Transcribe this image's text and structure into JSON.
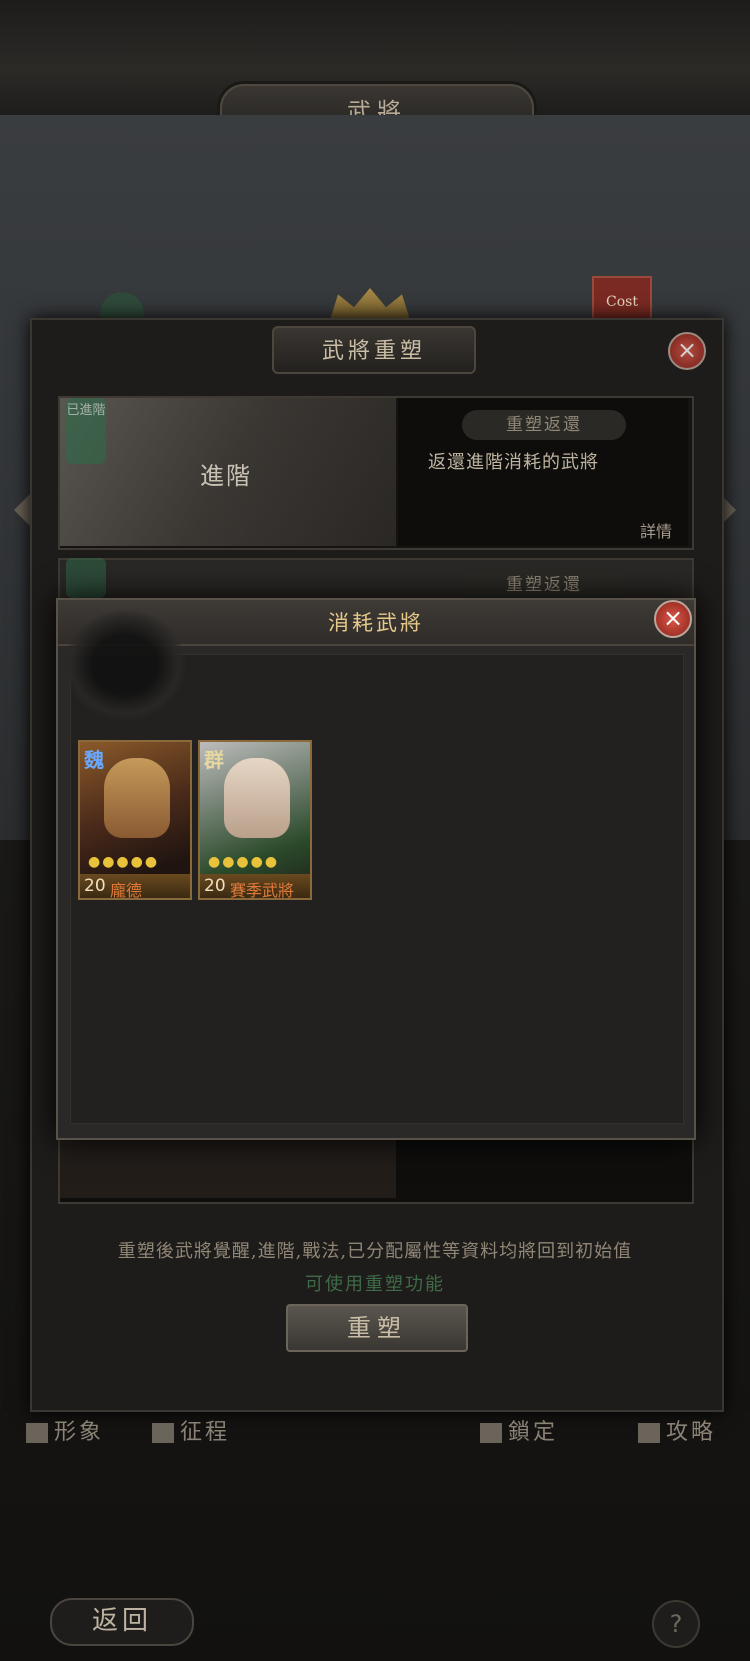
{
  "header": {
    "title": "武將"
  },
  "cost_badge": "Cost",
  "reset_dialog": {
    "title": "武將重塑",
    "card1": {
      "tag": "已進階",
      "label": "進階",
      "button": "重塑返還",
      "description": "返還進階消耗的武將",
      "detail_link": "詳情"
    },
    "card2": {
      "button": "重塑返還"
    },
    "note": "重塑後武將覺醒,進階,戰法,已分配屬性等資料均將回到初始值",
    "hint": "可使用重塑功能",
    "reset_button": "重塑"
  },
  "bottom_nav": {
    "image": "形象",
    "journey": "征程",
    "lock": "鎖定",
    "guide": "攻略"
  },
  "back_button": "返回",
  "help_button": "?",
  "consume_dialog": {
    "title": "消耗武將",
    "generals": [
      {
        "faction": "魏",
        "level": "20",
        "name": "龐德",
        "stars": "●●●●●"
      },
      {
        "faction": "群",
        "level": "20",
        "name": "賽季武將",
        "stars": "●●●●●"
      }
    ]
  },
  "colors": {
    "accent": "#e5c98a",
    "hint_green": "#3f6a48",
    "close_red": "#c0392b"
  }
}
